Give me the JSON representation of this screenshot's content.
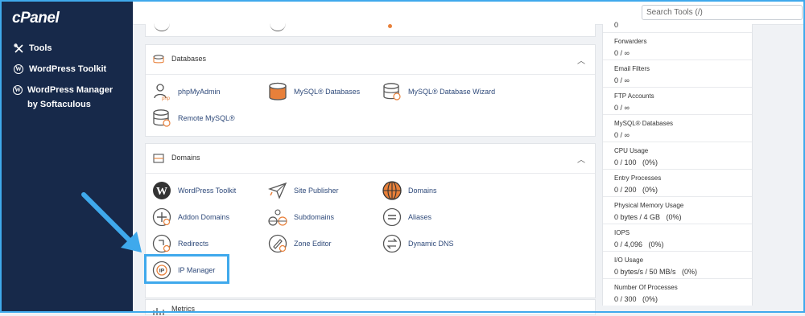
{
  "sidebar": {
    "logo": "cPanel",
    "items": [
      {
        "label": "Tools"
      },
      {
        "label": "WordPress Toolkit"
      },
      {
        "label": "WordPress Manager by Softaculous"
      }
    ]
  },
  "topbar": {
    "search_placeholder": "Search Tools (/)"
  },
  "databases": {
    "title": "Databases",
    "tools": [
      {
        "label": "phpMyAdmin"
      },
      {
        "label": "MySQL® Databases"
      },
      {
        "label": "MySQL® Database Wizard"
      },
      {
        "label": "Remote MySQL®"
      }
    ]
  },
  "domains": {
    "title": "Domains",
    "tools": [
      {
        "label": "WordPress Toolkit"
      },
      {
        "label": "Site Publisher"
      },
      {
        "label": "Domains"
      },
      {
        "label": "Addon Domains"
      },
      {
        "label": "Subdomains"
      },
      {
        "label": "Aliases"
      },
      {
        "label": "Redirects"
      },
      {
        "label": "Zone Editor"
      },
      {
        "label": "Dynamic DNS"
      },
      {
        "label": "IP Manager"
      }
    ]
  },
  "metrics": {
    "title": "Metrics"
  },
  "stats": [
    {
      "label": "Forwarders",
      "value": "0 / ∞"
    },
    {
      "label": "Email Filters",
      "value": "0 / ∞"
    },
    {
      "label": "FTP Accounts",
      "value": "0 / ∞"
    },
    {
      "label": "MySQL® Databases",
      "value": "0 / ∞"
    },
    {
      "label": "CPU Usage",
      "value": "0 / 100   (0%)"
    },
    {
      "label": "Entry Processes",
      "value": "0 / 200   (0%)"
    },
    {
      "label": "Physical Memory Usage",
      "value": "0 bytes / 4 GB   (0%)"
    },
    {
      "label": "IOPS",
      "value": "0 / 4,096   (0%)"
    },
    {
      "label": "I/O Usage",
      "value": "0 bytes/s / 50 MB/s   (0%)"
    },
    {
      "label": "Number Of Processes",
      "value": "0 / 300   (0%)"
    }
  ],
  "colors": {
    "sidebar_bg": "#17294a",
    "accent": "#e8803a",
    "highlight": "#3fa9ec"
  }
}
